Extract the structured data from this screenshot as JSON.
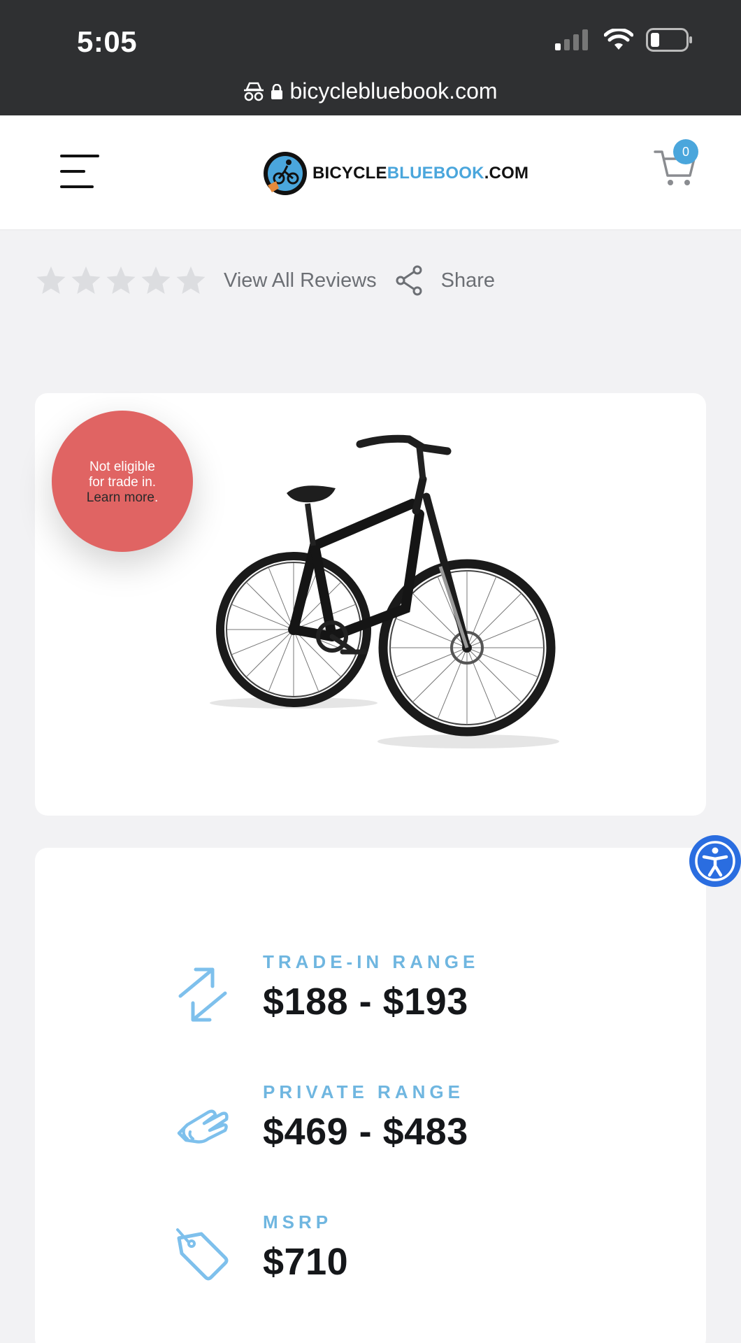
{
  "status_bar": {
    "time": "5:05",
    "url": "bicyclebluebook.com"
  },
  "header": {
    "logo_text_dark": "BICYCLE",
    "logo_text_blue": "BLUEBOOK",
    "logo_text_suffix": ".COM",
    "cart_count": "0"
  },
  "reviews": {
    "rating": 0,
    "max_rating": 5,
    "view_all_label": "View All Reviews",
    "share_label": "Share"
  },
  "product_image": {
    "badge_line1": "Not eligible",
    "badge_line2": "for trade in.",
    "badge_link": "Learn more",
    "badge_period": "."
  },
  "pricing": {
    "trade_in": {
      "label": "TRADE-IN RANGE",
      "value": "$188 - $193"
    },
    "private": {
      "label": "PRIVATE RANGE",
      "value": "$469 - $483"
    },
    "msrp": {
      "label": "MSRP",
      "value": "$710"
    }
  },
  "colors": {
    "accent_blue": "#4aa6dc",
    "label_blue": "#6fb6e0",
    "badge_red": "#e06463",
    "accessibility_blue": "#2a6de0"
  }
}
